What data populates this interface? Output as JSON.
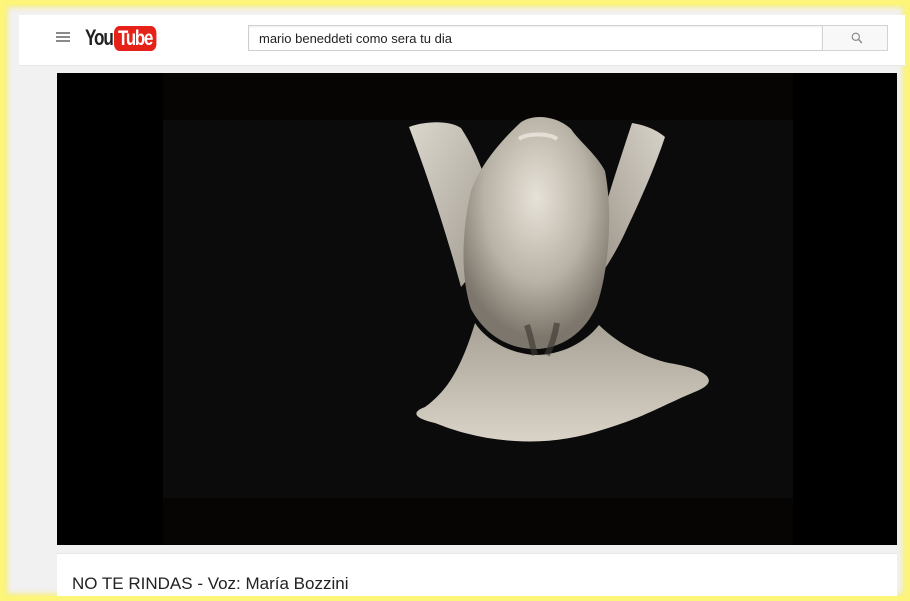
{
  "masthead": {
    "menu_icon": "hamburger-menu-icon",
    "logo": {
      "you": "You",
      "tube": "Tube",
      "brand_color": "#e62117"
    },
    "search": {
      "value": "mario beneddeti como sera tu dia",
      "button_icon": "search-icon"
    }
  },
  "video": {
    "title": "NO TE RINDAS - Voz: María Bozzini"
  },
  "colors": {
    "highlight_border": "#fdf57a",
    "player_background": "#000000",
    "page_background": "#f1f1f1"
  }
}
